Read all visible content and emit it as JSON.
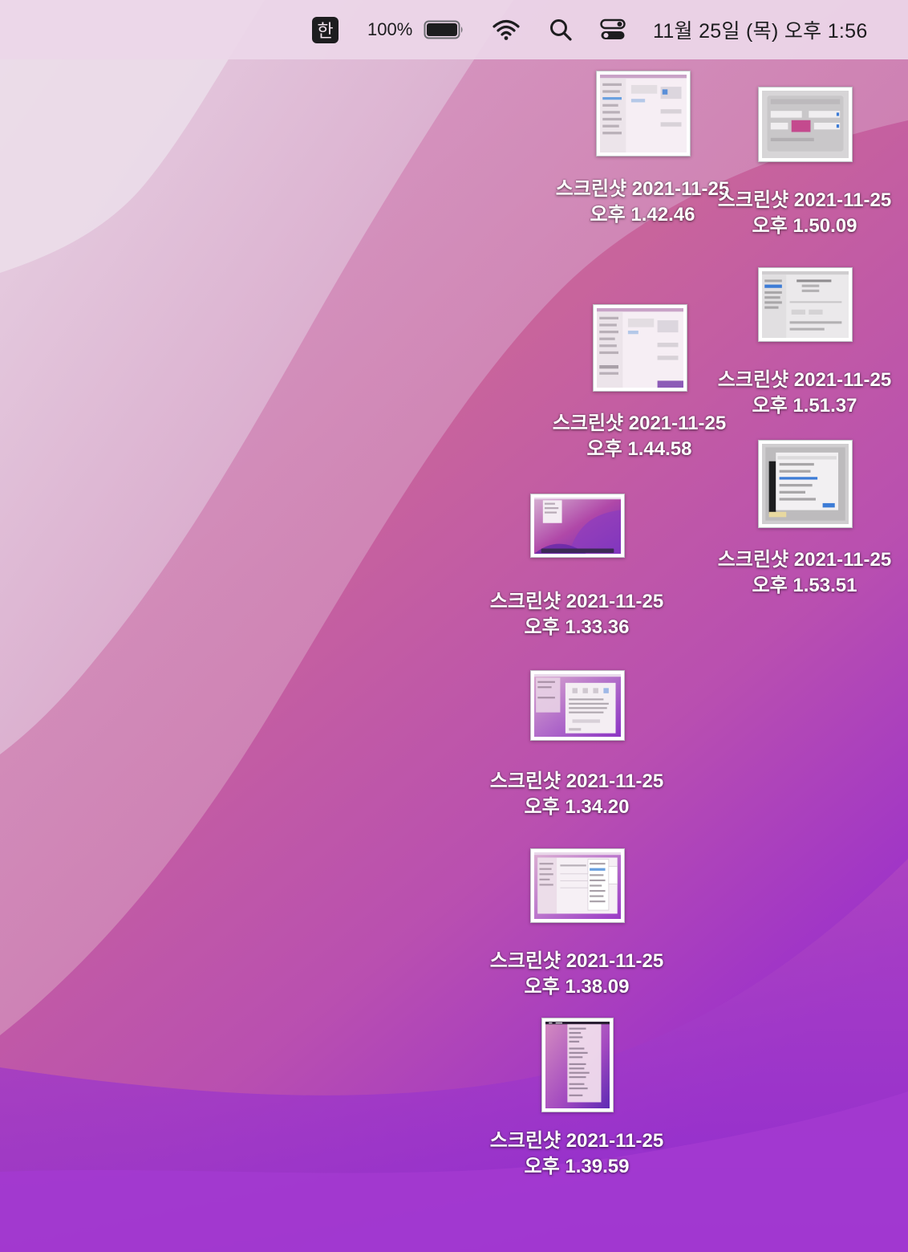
{
  "menubar": {
    "input_source": "한",
    "battery_percent": "100%",
    "battery_level": 1.0,
    "icons": [
      "battery-icon",
      "wifi-icon",
      "search-icon",
      "control-center-icon"
    ],
    "clock": "11월 25일 (목) 오후  1:56"
  },
  "desktop": {
    "files": [
      {
        "name_line1": "스크린샷 2021-11-25",
        "name_line2": "오후 1.42.46",
        "kind": "screenshot"
      },
      {
        "name_line1": "스크린샷 2021-11-25",
        "name_line2": "오후 1.50.09",
        "kind": "screenshot"
      },
      {
        "name_line1": "스크린샷 2021-11-25",
        "name_line2": "오후 1.51.37",
        "kind": "screenshot"
      },
      {
        "name_line1": "스크린샷 2021-11-25",
        "name_line2": "오후 1.44.58",
        "kind": "screenshot"
      },
      {
        "name_line1": "스크린샷 2021-11-25",
        "name_line2": "오후 1.53.51",
        "kind": "screenshot"
      },
      {
        "name_line1": "스크린샷 2021-11-25",
        "name_line2": "오후 1.33.36",
        "kind": "screenshot"
      },
      {
        "name_line1": "스크린샷 2021-11-25",
        "name_line2": "오후 1.34.20",
        "kind": "screenshot"
      },
      {
        "name_line1": "스크린샷 2021-11-25",
        "name_line2": "오후 1.38.09",
        "kind": "screenshot"
      },
      {
        "name_line1": "스크린샷 2021-11-25",
        "name_line2": "오후 1.39.59",
        "kind": "screenshot"
      }
    ]
  },
  "colors": {
    "wallpaper_light": "#e3cde0",
    "wallpaper_mid": "#c8649c",
    "wallpaper_deep": "#9a2fcc",
    "menubar_bg": "#ecd6e8",
    "label_text": "#ffffff"
  }
}
